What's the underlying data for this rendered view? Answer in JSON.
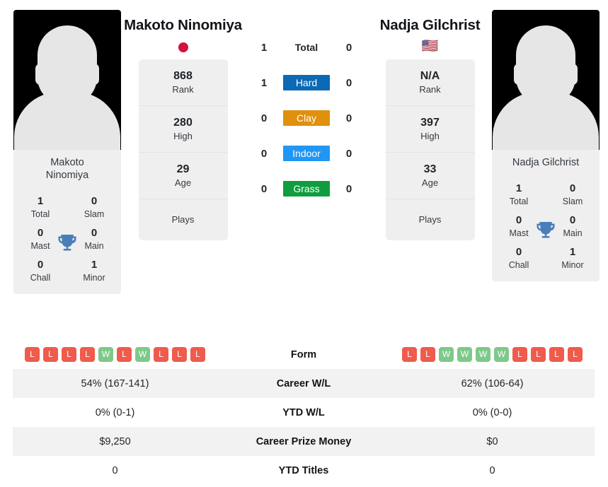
{
  "players": {
    "left": {
      "name": "Makoto Ninomiya",
      "caption_line1": "Makoto",
      "caption_line2": "Ninomiya",
      "flag_type": "circle",
      "flag_label": "japan-flag",
      "flag_color": "#d3113f",
      "stats": [
        {
          "value": "868",
          "label": "Rank"
        },
        {
          "value": "280",
          "label": "High"
        },
        {
          "value": "29",
          "label": "Age"
        },
        {
          "value": "",
          "label": "Plays"
        }
      ],
      "titles": [
        {
          "value": "1",
          "label": "Total"
        },
        {
          "value": "0",
          "label": "Slam"
        },
        {
          "value": "0",
          "label": "Mast"
        },
        {
          "value": "0",
          "label": "Main"
        },
        {
          "value": "0",
          "label": "Chall"
        },
        {
          "value": "1",
          "label": "Minor"
        }
      ],
      "form": [
        "L",
        "L",
        "L",
        "L",
        "W",
        "L",
        "W",
        "L",
        "L",
        "L"
      ]
    },
    "right": {
      "name": "Nadja Gilchrist",
      "caption_line1": "Nadja Gilchrist",
      "caption_line2": "",
      "flag_type": "emoji",
      "flag_label": "usa-flag",
      "flag_emoji": "🇺🇸",
      "stats": [
        {
          "value": "N/A",
          "label": "Rank"
        },
        {
          "value": "397",
          "label": "High"
        },
        {
          "value": "33",
          "label": "Age"
        },
        {
          "value": "",
          "label": "Plays"
        }
      ],
      "titles": [
        {
          "value": "1",
          "label": "Total"
        },
        {
          "value": "0",
          "label": "Slam"
        },
        {
          "value": "0",
          "label": "Mast"
        },
        {
          "value": "0",
          "label": "Main"
        },
        {
          "value": "0",
          "label": "Chall"
        },
        {
          "value": "1",
          "label": "Minor"
        }
      ],
      "form": [
        "L",
        "L",
        "W",
        "W",
        "W",
        "W",
        "L",
        "L",
        "L",
        "L"
      ]
    }
  },
  "surfaces": [
    {
      "label": "Total",
      "left": "1",
      "right": "0",
      "color": "transparent",
      "plain": true
    },
    {
      "label": "Hard",
      "left": "1",
      "right": "0",
      "color": "#0b69b5",
      "plain": false
    },
    {
      "label": "Clay",
      "left": "0",
      "right": "0",
      "color": "#e0900c",
      "plain": false
    },
    {
      "label": "Indoor",
      "left": "0",
      "right": "0",
      "color": "#2196f3",
      "plain": false
    },
    {
      "label": "Grass",
      "left": "0",
      "right": "0",
      "color": "#0f9d3f",
      "plain": false
    }
  ],
  "comparison_rows": [
    {
      "label": "Form",
      "left": "",
      "right": "",
      "type": "form",
      "shaded": false
    },
    {
      "label": "Career W/L",
      "left": "54% (167-141)",
      "right": "62% (106-64)",
      "type": "text",
      "shaded": true
    },
    {
      "label": "YTD W/L",
      "left": "0% (0-1)",
      "right": "0% (0-0)",
      "type": "text",
      "shaded": false
    },
    {
      "label": "Career Prize Money",
      "left": "$9,250",
      "right": "$0",
      "type": "text",
      "shaded": true
    },
    {
      "label": "YTD Titles",
      "left": "0",
      "right": "0",
      "type": "text",
      "shaded": false
    }
  ],
  "icons": {
    "trophy_color": "#4a7ebb",
    "trophy_label": "trophy-icon"
  }
}
